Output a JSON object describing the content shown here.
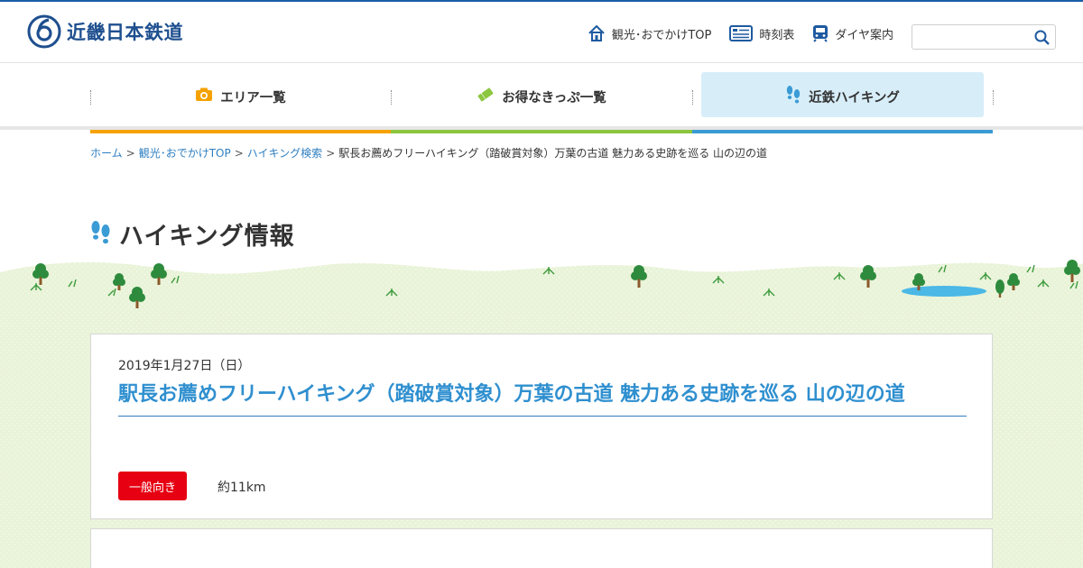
{
  "brand": {
    "name": "近畿日本鉄道"
  },
  "header_links": [
    {
      "label": "観光･おでかけTOP",
      "icon": "home-icon"
    },
    {
      "label": "時刻表",
      "icon": "timetable-icon"
    },
    {
      "label": "ダイヤ案内",
      "icon": "train-icon"
    }
  ],
  "search": {
    "value": "",
    "placeholder": ""
  },
  "nav": [
    {
      "label": "エリア一覧",
      "icon": "camera-icon",
      "accent": "#f5a200",
      "active": false
    },
    {
      "label": "お得なきっぷ一覧",
      "icon": "ticket-icon",
      "accent": "#8cc63f",
      "active": false
    },
    {
      "label": "近鉄ハイキング",
      "icon": "footprints-icon",
      "accent": "#3a9bd5",
      "active": true
    }
  ],
  "breadcrumb": {
    "home": "ホーム",
    "sightseeing": "観光･おでかけTOP",
    "hiking_search": "ハイキング検索",
    "current": "駅長お薦めフリーハイキング（踏破賞対象）万葉の古道 魅力ある史跡を巡る 山の辺の道",
    "separator": ">"
  },
  "page": {
    "title": "ハイキング情報"
  },
  "event": {
    "date": "2019年1月27日（日）",
    "title": "駅長お薦めフリーハイキング（踏破賞対象）万葉の古道 魅力ある史跡を巡る 山の辺の道",
    "level": "一般向き",
    "distance": "約11km"
  },
  "colors": {
    "brand_blue": "#1e4f8f",
    "link_blue": "#2f7fc1",
    "title_blue": "#2f8fcf",
    "badge_red": "#e60012",
    "grass": "#e9f4d8"
  }
}
